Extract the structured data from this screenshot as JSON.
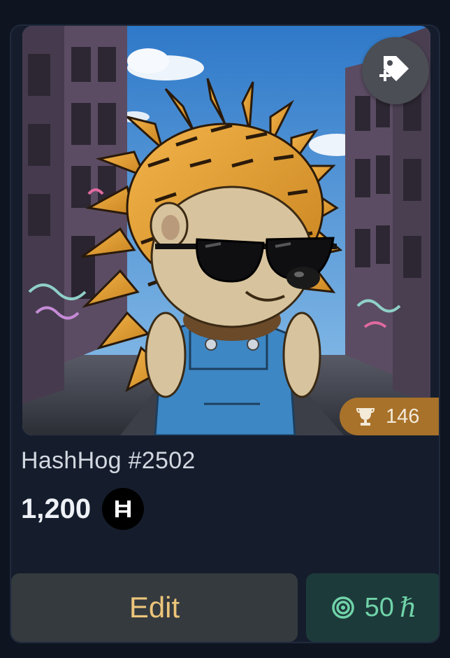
{
  "card": {
    "name": "HashHog #2502",
    "price": "1,200",
    "currency_icon": "hbar-icon",
    "currency_glyph": "Ħ",
    "trophy_count": "146",
    "image_alt": "HashHog #2502",
    "tag_icon": "tag-add-icon"
  },
  "actions": {
    "edit_label": "Edit",
    "stake_amount": "50",
    "stake_unit": "ℏ",
    "stake_icon": "target-icon"
  },
  "colors": {
    "card_bg": "#151d2d",
    "page_bg": "#0e1420",
    "edit_text": "#ecc57a",
    "stake_text": "#6fd3a8",
    "trophy_bg": "#a8722a"
  }
}
